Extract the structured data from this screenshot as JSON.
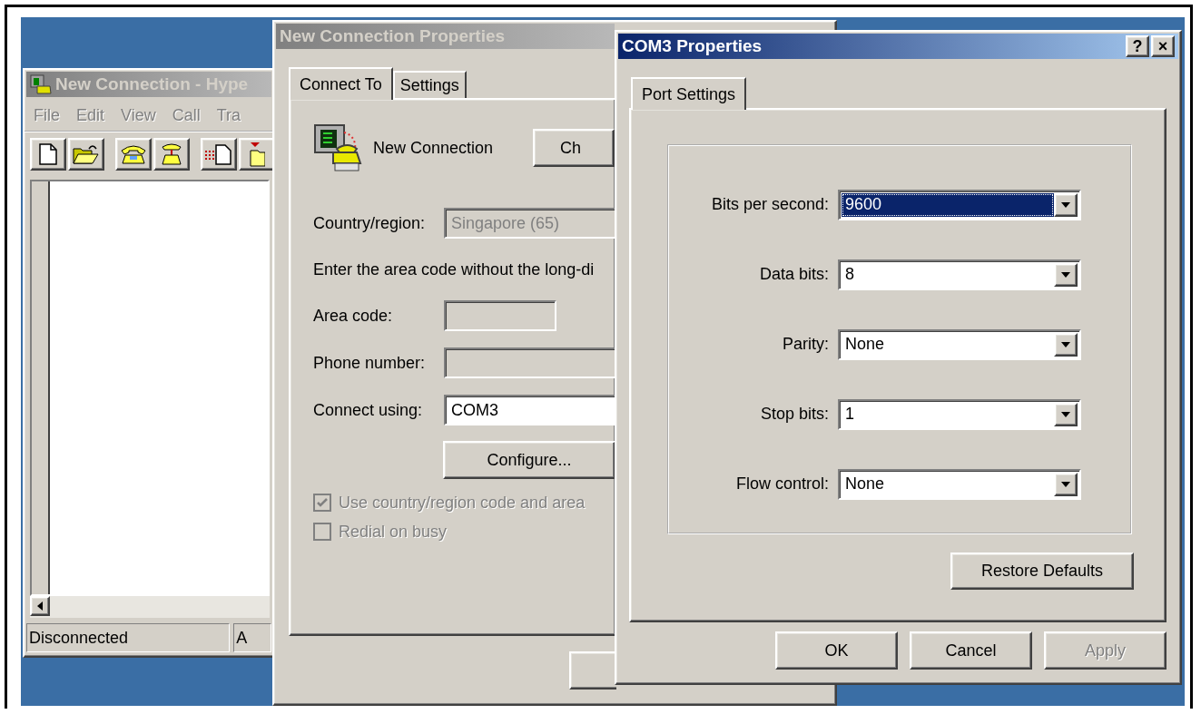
{
  "hyperterminal": {
    "title": "New Connection - Hype",
    "menu": [
      "File",
      "Edit",
      "View",
      "Call",
      "Tra"
    ],
    "status": [
      "Disconnected",
      "A"
    ]
  },
  "connection_properties": {
    "title": "New Connection Properties",
    "tabs": [
      {
        "label": "Connect To",
        "selected": true
      },
      {
        "label": "Settings",
        "selected": false
      }
    ],
    "connection_name": "New Connection",
    "change_icon_button": "Ch",
    "country": {
      "label": "Country/region:",
      "value": "Singapore (65)",
      "disabled": true
    },
    "note": "Enter the area code without the long-di",
    "fields": [
      {
        "label": "Area code:",
        "disabled": true
      },
      {
        "label": "Phone number:",
        "disabled": true
      },
      {
        "label": "Connect using:",
        "value": "COM3",
        "disabled": false
      }
    ],
    "configure_button": "Configure...",
    "checkboxes": [
      {
        "label": "Use country/region code and area",
        "checked": true,
        "disabled": true
      },
      {
        "label": "Redial on busy",
        "checked": false,
        "disabled": true
      }
    ]
  },
  "port_properties": {
    "title": "COM3 Properties",
    "help_button": "?",
    "close_button": "×",
    "tabs": [
      {
        "label": "Port Settings",
        "selected": true
      }
    ],
    "settings": [
      {
        "label": "Bits per second:",
        "value": "9600",
        "selected": true
      },
      {
        "label": "Data bits:",
        "value": "8",
        "selected": false
      },
      {
        "label": "Parity:",
        "value": "None",
        "selected": false
      },
      {
        "label": "Stop bits:",
        "value": "1",
        "selected": false
      },
      {
        "label": "Flow control:",
        "value": "None",
        "selected": false
      }
    ],
    "restore_button": "Restore Defaults",
    "buttons": [
      {
        "label": "OK",
        "disabled": false
      },
      {
        "label": "Cancel",
        "disabled": false
      },
      {
        "label": "Apply",
        "disabled": true
      }
    ]
  }
}
